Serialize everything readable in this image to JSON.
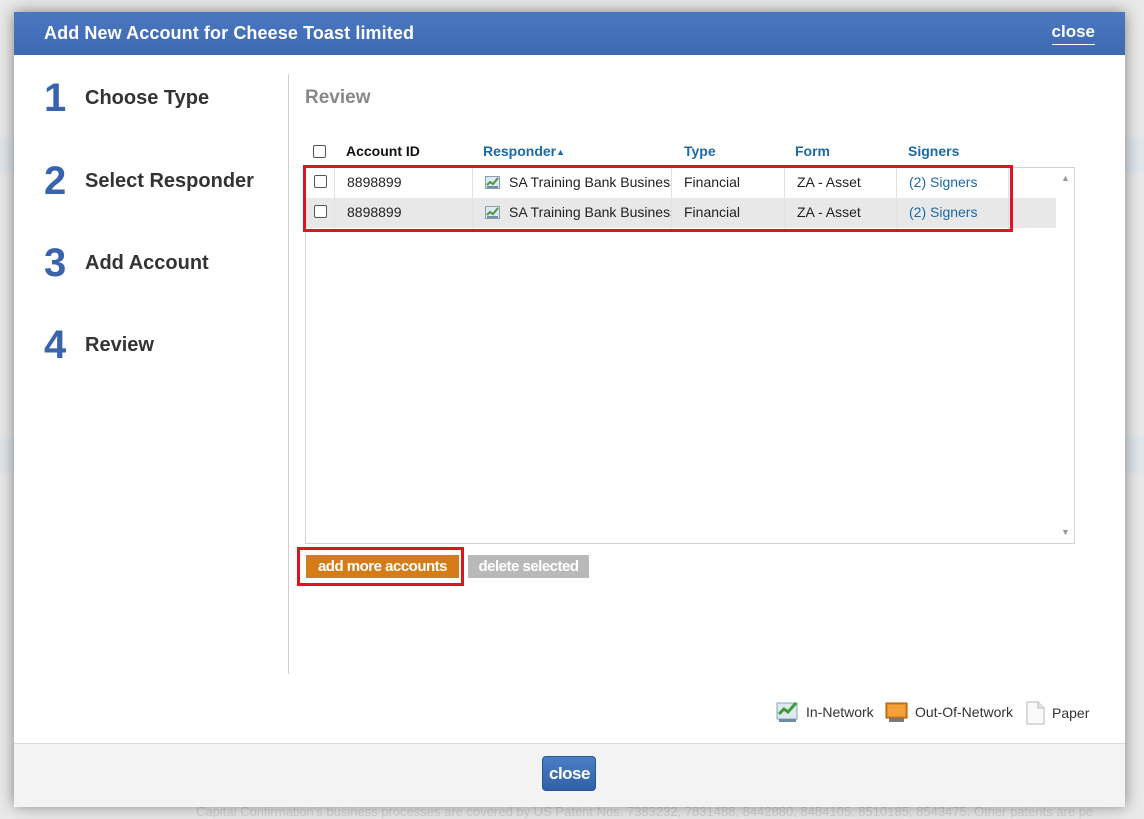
{
  "background": {
    "footer_text": "Capital Confirmation's business processes are covered by US Patent Nos. 7383232, 7831488, 8442880, 8484105, 8510185, 8543475. Other patents are pe"
  },
  "modal": {
    "title": "Add New Account for Cheese Toast limited",
    "header_close": "close",
    "footer_close": "close"
  },
  "steps": [
    {
      "number": "1",
      "label": "Choose Type"
    },
    {
      "number": "2",
      "label": "Select Responder"
    },
    {
      "number": "3",
      "label": "Add Account"
    },
    {
      "number": "4",
      "label": "Review"
    }
  ],
  "review": {
    "title": "Review",
    "columns": {
      "account_id": "Account ID",
      "responder": "Responder",
      "responder_sort": "▲",
      "type": "Type",
      "form": "Form",
      "signers": "Signers"
    },
    "rows": [
      {
        "account_id": "8898899",
        "responder": "SA Training Bank Business",
        "type": "Financial",
        "form": "ZA - Asset",
        "signers": "(2) Signers",
        "responder_icon": "in-network-icon"
      },
      {
        "account_id": "8898899",
        "responder": "SA Training Bank Business",
        "type": "Financial",
        "form": "ZA - Asset",
        "signers": "(2) Signers",
        "responder_icon": "in-network-icon"
      }
    ],
    "buttons": {
      "add_more": "add more accounts",
      "delete_selected": "delete selected"
    },
    "legend": {
      "in_network": "In-Network",
      "out_of_network": "Out-Of-Network",
      "paper": "Paper"
    }
  },
  "colors": {
    "header_blue": "#4372ba",
    "accent_orange": "#d47c16",
    "link_blue": "#1a6aa8",
    "highlight_red": "#e0141e"
  }
}
